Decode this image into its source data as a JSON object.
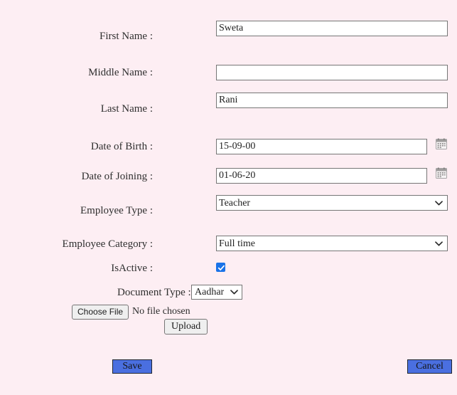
{
  "page": {
    "background_color": "#fdeef3",
    "accent_color": "#4a6fe0",
    "checkbox_color": "#1a73e8"
  },
  "fields": {
    "first_name": {
      "label": "First Name :",
      "value": "Sweta",
      "placeholder": ""
    },
    "middle_name": {
      "label": "Middle Name :",
      "value": "",
      "placeholder": ""
    },
    "last_name": {
      "label": "Last Name :",
      "value": "Rani",
      "placeholder": ""
    },
    "date_of_birth": {
      "label": "Date of Birth :",
      "value": "15-09-00",
      "placeholder": ""
    },
    "date_of_joining": {
      "label": "Date of Joining :",
      "value": "01-06-20",
      "placeholder": ""
    },
    "employee_type": {
      "label": "Employee Type :",
      "value": "Teacher",
      "options": [
        "Teacher"
      ]
    },
    "employee_category": {
      "label": "Employee Category :",
      "value": "Full time",
      "options": [
        "Full time"
      ]
    },
    "is_active": {
      "label": "IsActive :",
      "checked": true
    },
    "document_type": {
      "label": "Document Type :",
      "value": "Aadhar",
      "options": [
        "Aadhar"
      ]
    },
    "file_upload": {
      "choose_label": "Choose File",
      "status_text": "No file chosen",
      "upload_label": "Upload"
    }
  },
  "actions": {
    "save_label": "Save",
    "cancel_label": "Cancel"
  },
  "icons": {
    "calendar": "calendar-icon",
    "chevron": "chevron-down-icon",
    "check": "check-icon"
  }
}
